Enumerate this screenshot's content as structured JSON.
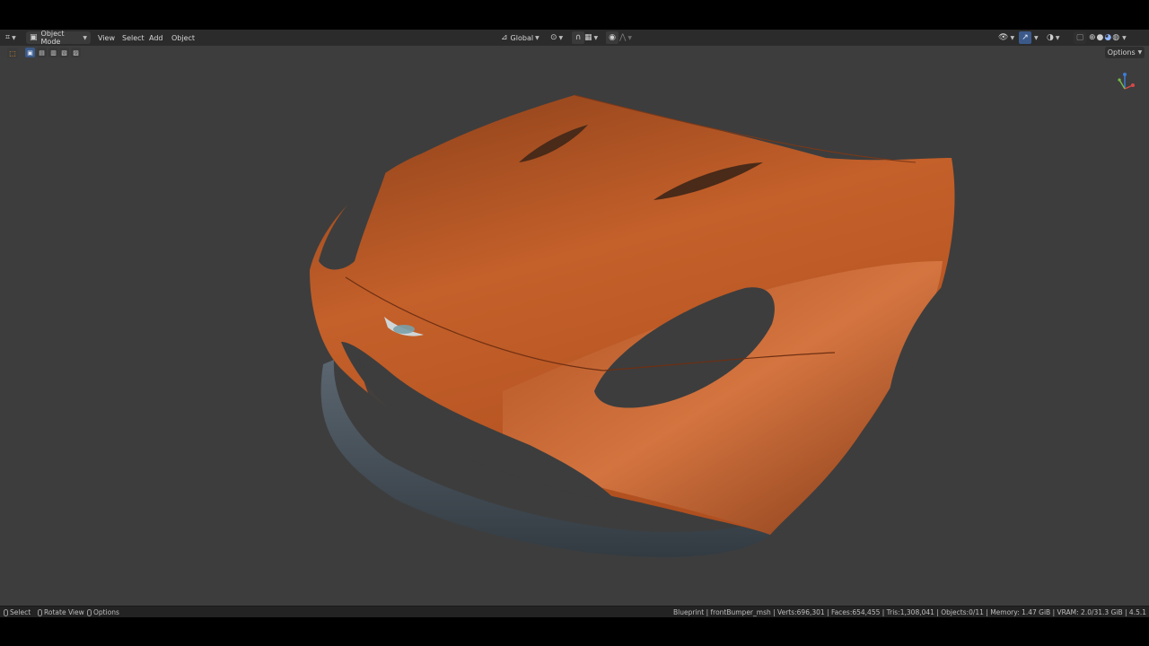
{
  "header": {
    "editor_type_icon": "axis-editor-icon",
    "mode_label": "Object Mode",
    "menus": [
      "View",
      "Select",
      "Add",
      "Object"
    ],
    "transform_orientation": "Global",
    "pivot_icon": "pivot-icon",
    "snap_icon": "magnet-icon",
    "proportional_icon": "proportional-edit-icon"
  },
  "toolbar": {
    "options_label": "Options"
  },
  "viewport": {
    "body_color": "#c4602a",
    "splitter_color": "#4a5560",
    "background_color": "#3d3d3d",
    "gizmo_labels": {
      "x": "",
      "y": "",
      "z": ""
    }
  },
  "statusbar": {
    "hints": [
      {
        "icon": "left-mouse-icon",
        "label": "Select"
      },
      {
        "icon": "middle-mouse-icon",
        "label": "Rotate View"
      },
      {
        "icon": "right-mouse-icon",
        "label": "Options"
      }
    ],
    "scene_stats": "Blueprint | frontBumper_msh | Verts:696,301 | Faces:654,455 | Tris:1,308,041 | Objects:0/11 | Memory: 1.47 GiB | VRAM: 2.0/31.3 GiB | 4.5.1"
  }
}
